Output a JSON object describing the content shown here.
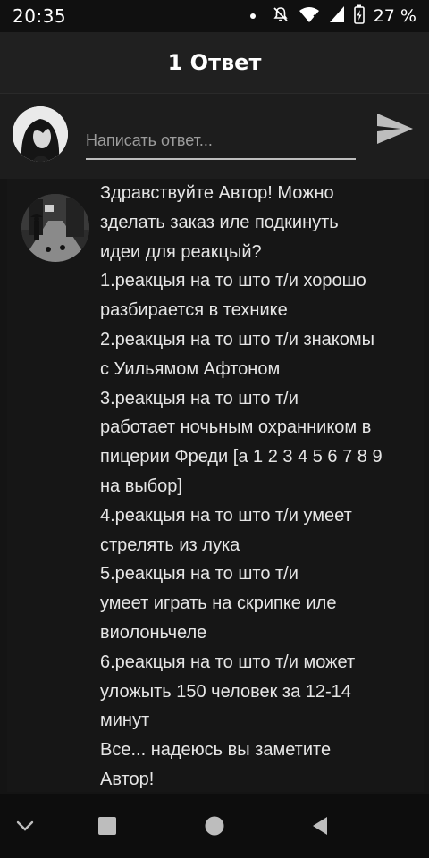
{
  "status_bar": {
    "time": "20:35",
    "battery_percent": "27 %",
    "icons": [
      "notification-dot",
      "mute-icon",
      "wifi-icon",
      "signal-icon",
      "battery-charging-icon"
    ]
  },
  "header": {
    "title": "1 Ответ"
  },
  "reply": {
    "placeholder": "Написать ответ...",
    "value": "",
    "send_icon": "send-icon"
  },
  "comment": {
    "lines": [
      "Здравствуйте Автор! Можно",
      "зделать заказ иле подкинуть",
      "идеи для реакцый?",
      "1.реакцыя на то што т/и хорошо",
      "разбирается в технике",
      "2.реакцыя на то што т/и знакомы",
      "с Уильямом Афтоном",
      "3.реакцыя на то што т/и",
      "работает ночьным охранником в",
      "пицерии Фреди [а 1 2 3 4 5 6 7 8 9",
      "на выбор]",
      "4.реакцыя на то што т/и умеет",
      "стрелять из лука",
      "5.реакцыя на то што т/и",
      "умеет играть на скрипке иле",
      "виолоньчеле",
      "6.реакцыя на то што т/и может",
      "уложыть 150 человек за 12-14",
      "минут",
      "Все... надеюсь вы заметите",
      "Автор!"
    ]
  },
  "nav_bar": {
    "icons": [
      "chevron-down-icon",
      "recents-square-icon",
      "home-circle-icon",
      "back-triangle-icon"
    ]
  },
  "colors": {
    "background": "#141414",
    "header": "#202020",
    "text": "#e6e6e6"
  }
}
